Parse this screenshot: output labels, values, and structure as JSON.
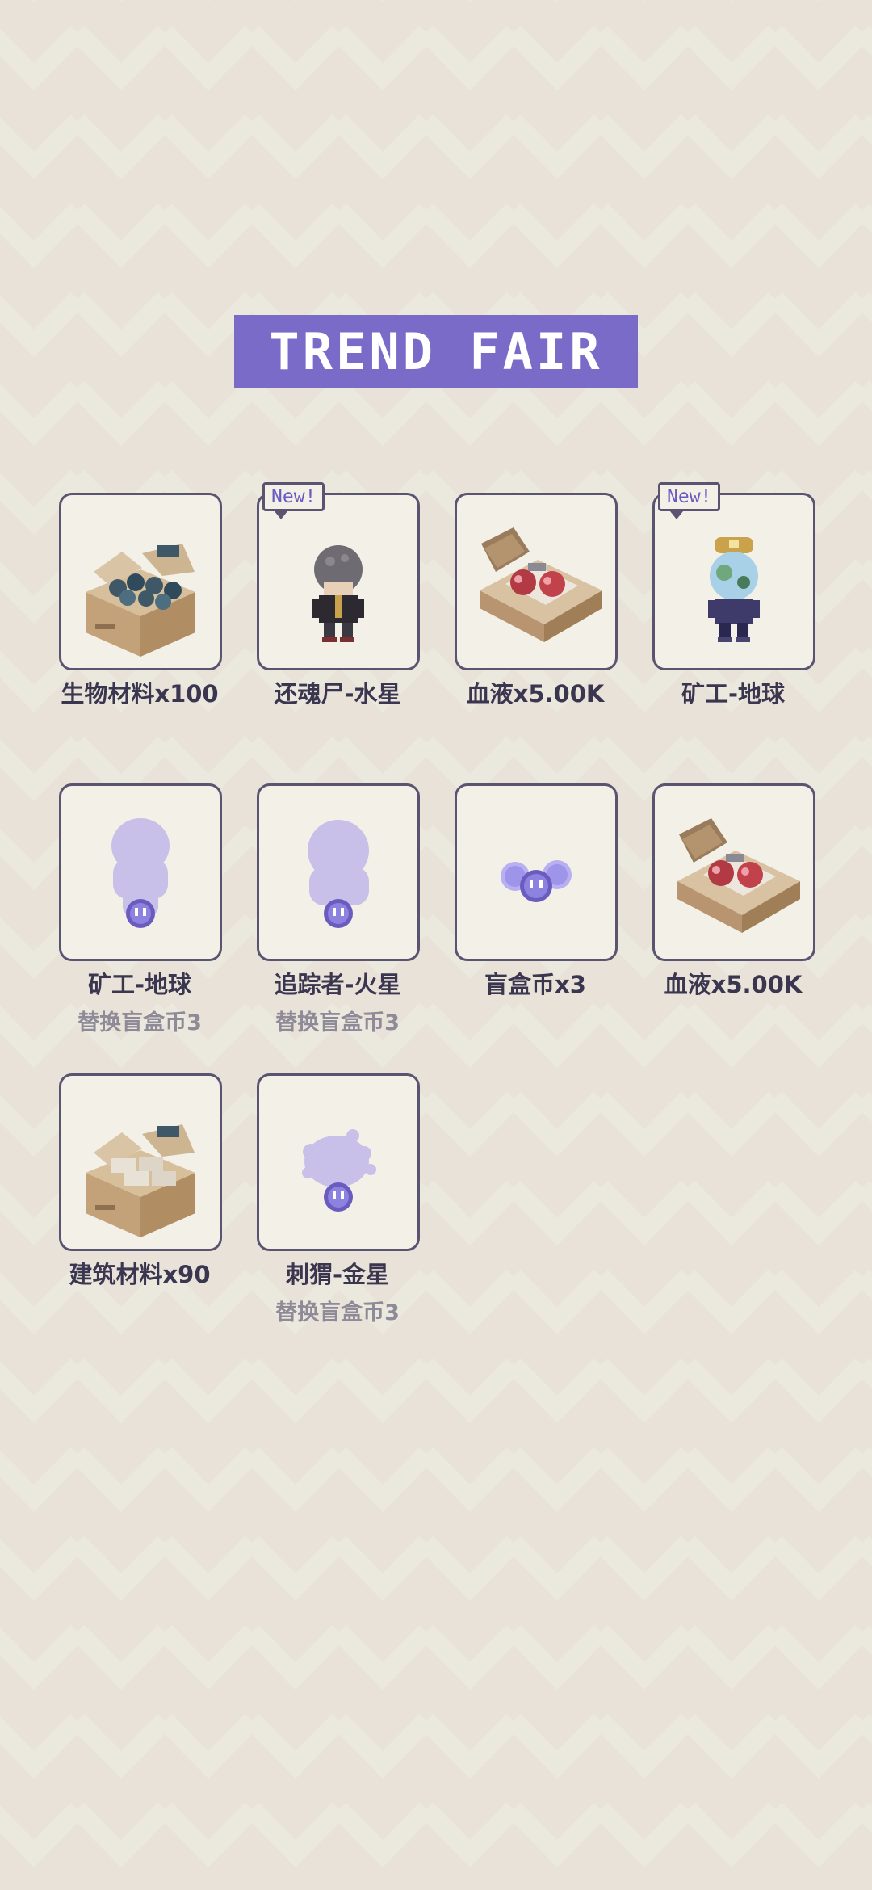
{
  "title": "TREND FAIR",
  "items": [
    {
      "label": "生物材料x100",
      "sub": "",
      "new": false,
      "icon": "material-box-icon"
    },
    {
      "label": "还魂尸-水星",
      "sub": "",
      "new": true,
      "icon": "zombie-character-icon"
    },
    {
      "label": "血液x5.00K",
      "sub": "",
      "new": false,
      "icon": "blood-box-icon"
    },
    {
      "label": "矿工-地球",
      "sub": "",
      "new": true,
      "icon": "miner-character-icon"
    },
    {
      "label": "矿工-地球",
      "sub": "替换盲盒币3",
      "new": false,
      "icon": "silhouette-icon"
    },
    {
      "label": "追踪者-火星",
      "sub": "替换盲盒币3",
      "new": false,
      "icon": "silhouette-icon"
    },
    {
      "label": "盲盒币x3",
      "sub": "",
      "new": false,
      "icon": "blindbox-coin-icon"
    },
    {
      "label": "血液x5.00K",
      "sub": "",
      "new": false,
      "icon": "blood-box-icon"
    },
    {
      "label": "建筑材料x90",
      "sub": "",
      "new": false,
      "icon": "building-material-box-icon"
    },
    {
      "label": "刺猬-金星",
      "sub": "替换盲盒币3",
      "new": false,
      "icon": "silhouette-splat-icon"
    }
  ],
  "new_tag": "New!",
  "colors": {
    "accent": "#7b6bc9",
    "card_border": "#5b5470",
    "card_bg": "#f3f0e8",
    "label": "#3b3650",
    "sublabel": "#8f8a98",
    "silhouette": "#c8c0e8"
  }
}
